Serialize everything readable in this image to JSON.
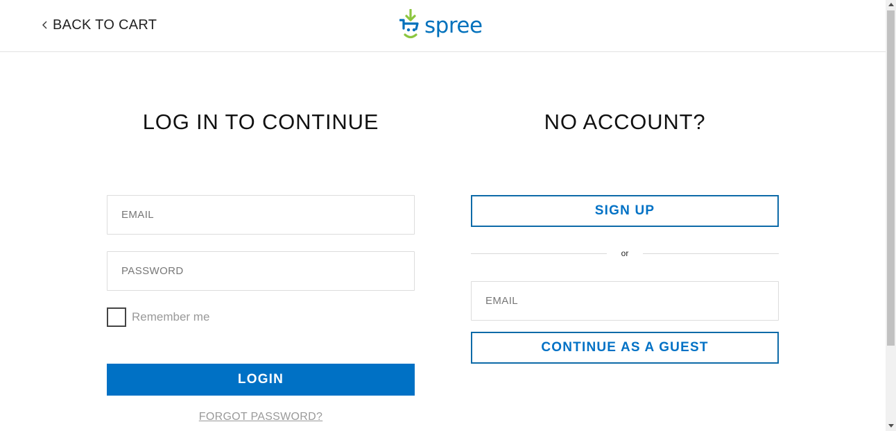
{
  "header": {
    "back_label": "BACK TO CART",
    "logo_text": "spree"
  },
  "login": {
    "heading": "LOG IN TO CONTINUE",
    "email_placeholder": "EMAIL",
    "password_placeholder": "PASSWORD",
    "remember_label": "Remember me",
    "login_button": "LOGIN",
    "forgot_link": "FORGOT PASSWORD?"
  },
  "guest": {
    "heading": "NO ACCOUNT?",
    "signup_button": "SIGN UP",
    "divider_text": "or",
    "email_placeholder": "EMAIL",
    "guest_button": "CONTINUE AS A GUEST"
  },
  "colors": {
    "brand_blue": "#0071c5",
    "logo_green": "#8cc63f",
    "logo_blue": "#0071bc"
  },
  "icons": {
    "back": "chevron-left-icon",
    "logo": "spree-cart-logo-icon"
  }
}
